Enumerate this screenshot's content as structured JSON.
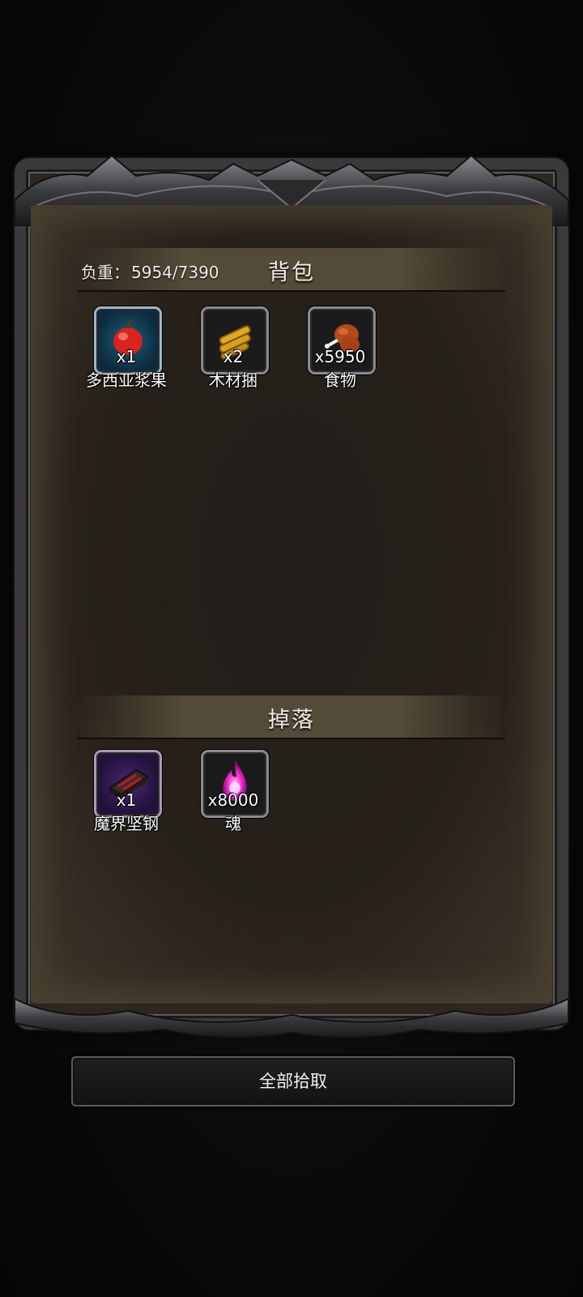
{
  "backpack": {
    "title": "背包",
    "weight_label": "负重：",
    "weight_value": "5954/7390",
    "items": [
      {
        "name": "多西亚浆果",
        "count": "x1",
        "icon": "apple-icon"
      },
      {
        "name": "木材捆",
        "count": "x2",
        "icon": "wood-bundle-icon"
      },
      {
        "name": "食物",
        "count": "x5950",
        "icon": "meat-icon"
      }
    ]
  },
  "drops": {
    "title": "掉落",
    "items": [
      {
        "name": "魔界坚钢",
        "count": "x1",
        "icon": "steel-ingot-icon"
      },
      {
        "name": "魂",
        "count": "x8000",
        "icon": "soul-flame-icon"
      }
    ]
  },
  "actions": {
    "pick_all": "全部拾取"
  },
  "colors": {
    "panel_bg": "#262119",
    "frame": "#3a3a3c",
    "text": "#f2ece2"
  }
}
